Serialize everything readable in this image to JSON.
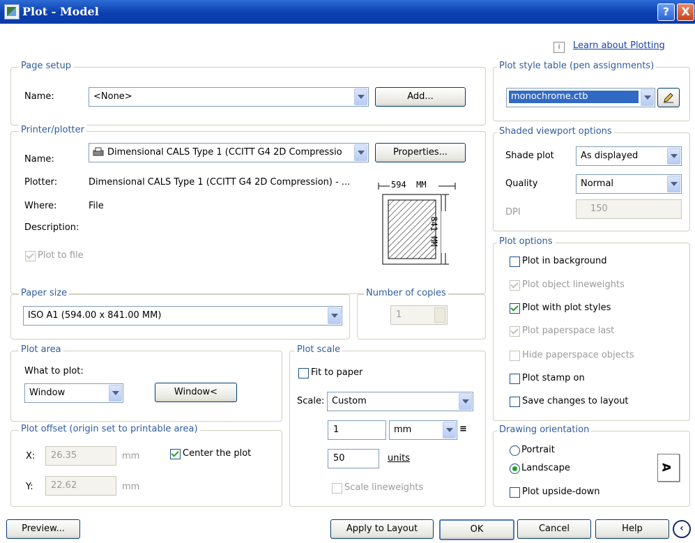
{
  "window": {
    "title": "Plot - Model",
    "help_btn": "?",
    "close_btn": "X"
  },
  "learn_link": "Learn about Plotting",
  "page_setup": {
    "legend": "Page setup",
    "name_label": "Name:",
    "name_value": "<None>",
    "add_button": "Add..."
  },
  "printer": {
    "legend": "Printer/plotter",
    "name_label": "Name:",
    "name_value": "Dimensional CALS Type 1 (CCITT G4 2D Compressio",
    "properties_button": "Properties...",
    "plotter_label": "Plotter:",
    "plotter_value": "Dimensional CALS Type 1 (CCITT G4 2D Compression) - ...",
    "where_label": "Where:",
    "where_value": "File",
    "description_label": "Description:",
    "plot_to_file": "Plot to file",
    "preview_width": "594  MM",
    "preview_height": "841 MM"
  },
  "paper_size": {
    "legend": "Paper size",
    "value": "ISO A1 (594.00 x 841.00 MM)"
  },
  "copies": {
    "legend": "Number of copies",
    "value": "1"
  },
  "plot_area": {
    "legend": "Plot area",
    "what_label": "What to plot:",
    "what_value": "Window",
    "window_button": "Window<"
  },
  "plot_offset": {
    "legend": "Plot offset (origin set to printable area)",
    "x_label": "X:",
    "x_value": "26.35",
    "x_unit": "mm",
    "y_label": "Y:",
    "y_value": "22.62",
    "y_unit": "mm",
    "center_label": "Center the plot"
  },
  "plot_scale": {
    "legend": "Plot scale",
    "fit_label": "Fit to paper",
    "scale_label": "Scale:",
    "scale_value": "Custom",
    "value1": "1",
    "unit1": "mm",
    "value2": "50",
    "unit2": "units",
    "lineweights_label": "Scale lineweights"
  },
  "style_table": {
    "legend": "Plot style table (pen assignments)",
    "value": "monochrome.ctb"
  },
  "shaded": {
    "legend": "Shaded viewport options",
    "shade_label": "Shade plot",
    "shade_value": "As displayed",
    "quality_label": "Quality",
    "quality_value": "Normal",
    "dpi_label": "DPI",
    "dpi_value": "150"
  },
  "plot_options": {
    "legend": "Plot options",
    "items": [
      {
        "label": "Plot in background",
        "checked": false,
        "enabled": true
      },
      {
        "label": "Plot object lineweights",
        "checked": true,
        "enabled": false
      },
      {
        "label": "Plot with plot styles",
        "checked": true,
        "enabled": true
      },
      {
        "label": "Plot paperspace last",
        "checked": true,
        "enabled": false
      },
      {
        "label": "Hide paperspace objects",
        "checked": false,
        "enabled": false
      },
      {
        "label": "Plot stamp on",
        "checked": false,
        "enabled": true
      },
      {
        "label": "Save changes to layout",
        "checked": false,
        "enabled": true
      }
    ]
  },
  "orientation": {
    "legend": "Drawing orientation",
    "portrait": "Portrait",
    "landscape": "Landscape",
    "upside_down": "Plot upside-down",
    "icon_glyph": "A"
  },
  "footer": {
    "preview": "Preview...",
    "apply": "Apply to Layout",
    "ok": "OK",
    "cancel": "Cancel",
    "help": "Help"
  }
}
